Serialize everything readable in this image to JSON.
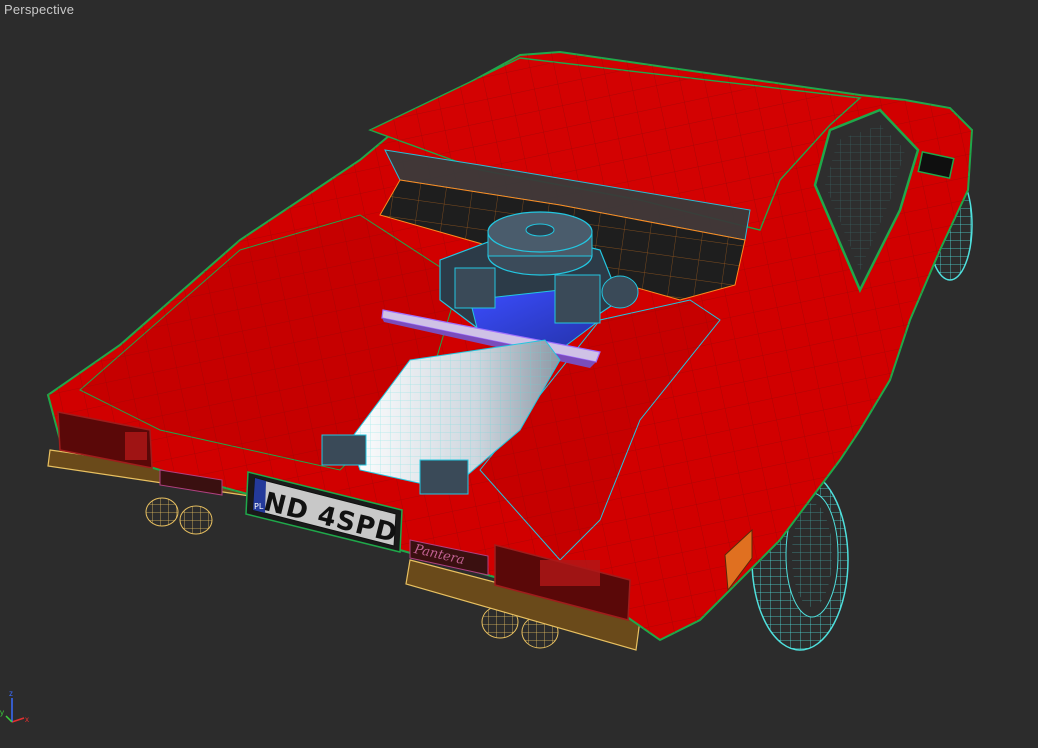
{
  "viewport": {
    "label": "Perspective",
    "background": "#2c2c2c"
  },
  "model": {
    "license_plate": "ND 4SPD",
    "plate_country": "PL",
    "rear_badge": "Pantera",
    "body_color": "#d10000",
    "wire_outer_color": "#1fa84a",
    "wire_inner_color": "#ff8a1e",
    "engine_wire_color": "#23c6e0",
    "tire_wire_color": "#4fe0dd",
    "exhaust_wire_color": "#e8c060"
  },
  "gizmo": {
    "icon": "axis-tripod-icon",
    "axes": [
      "x",
      "y",
      "z"
    ],
    "x_color": "#e23030",
    "y_color": "#3bd23b",
    "z_color": "#3a6cff"
  }
}
